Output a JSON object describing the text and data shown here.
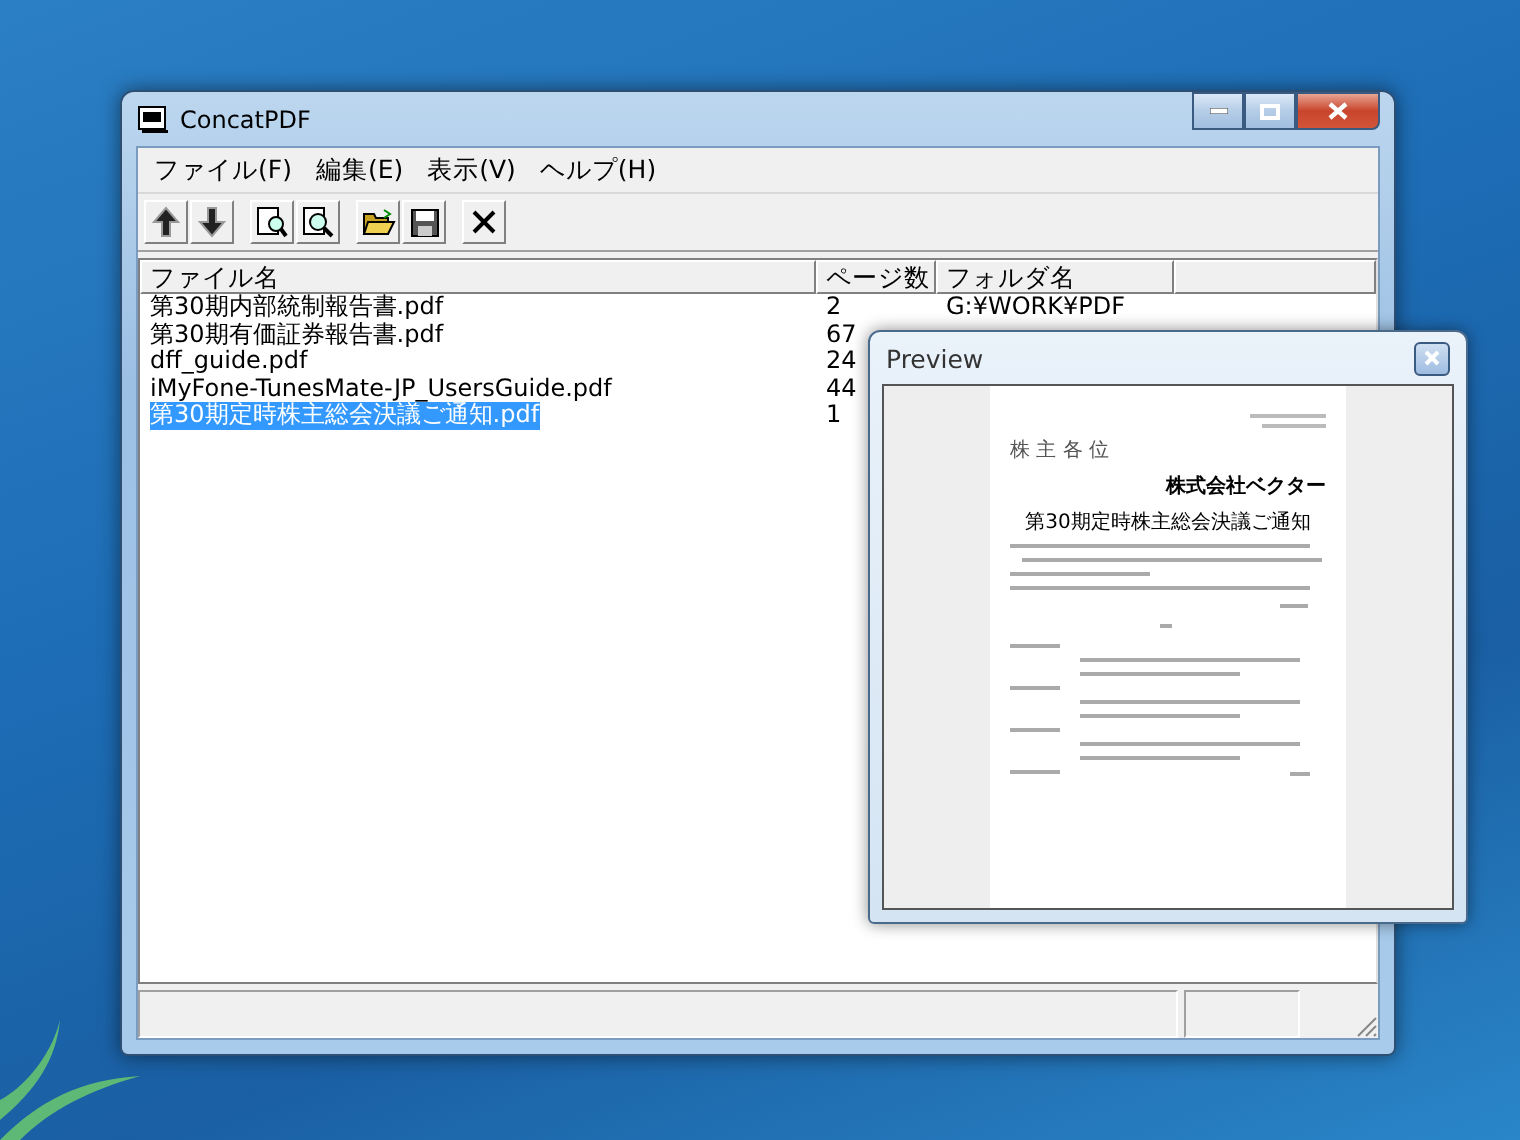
{
  "window": {
    "title": "ConcatPDF"
  },
  "menu": [
    {
      "label": "ファイル(F)"
    },
    {
      "label": "編集(E)"
    },
    {
      "label": "表示(V)"
    },
    {
      "label": "ヘルプ(H)"
    }
  ],
  "toolbar": [
    {
      "buttons": [
        {
          "kind": "up"
        },
        {
          "kind": "down"
        }
      ]
    },
    {
      "buttons": [
        {
          "kind": "page"
        },
        {
          "kind": "zoom"
        }
      ]
    },
    {
      "buttons": [
        {
          "kind": "open"
        },
        {
          "kind": "save"
        }
      ]
    },
    {
      "buttons": [
        {
          "kind": "delete"
        }
      ]
    }
  ],
  "table": {
    "columns": [
      "ファイル名",
      "ページ数",
      "フォルダ名"
    ],
    "rows": [
      {
        "name": "第30期内部統制報告書.pdf",
        "pages": "2",
        "folder": "G:¥WORK¥PDF",
        "selected": false
      },
      {
        "name": "第30期有価証券報告書.pdf",
        "pages": "67",
        "selected": false
      },
      {
        "name": "dff_guide.pdf",
        "pages": "24",
        "selected": false
      },
      {
        "name": "iMyFone-TunesMate-JP_UsersGuide.pdf",
        "pages": "44",
        "selected": false
      },
      {
        "name": "第30期定時株主総会決議ご通知.pdf",
        "pages": "1",
        "selected": true
      }
    ]
  },
  "preview": {
    "title": "Preview",
    "document": {
      "addressee": "株 主 各 位",
      "company": "株式会社ベクター",
      "heading": "第30期定時株主総会決議ご通知"
    }
  }
}
